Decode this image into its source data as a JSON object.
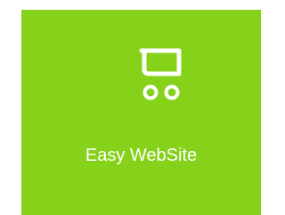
{
  "tile": {
    "label": "Easy WebSite",
    "icon": "shopping-cart-icon",
    "background_color": "#86d11a",
    "text_color": "#ffffff"
  }
}
